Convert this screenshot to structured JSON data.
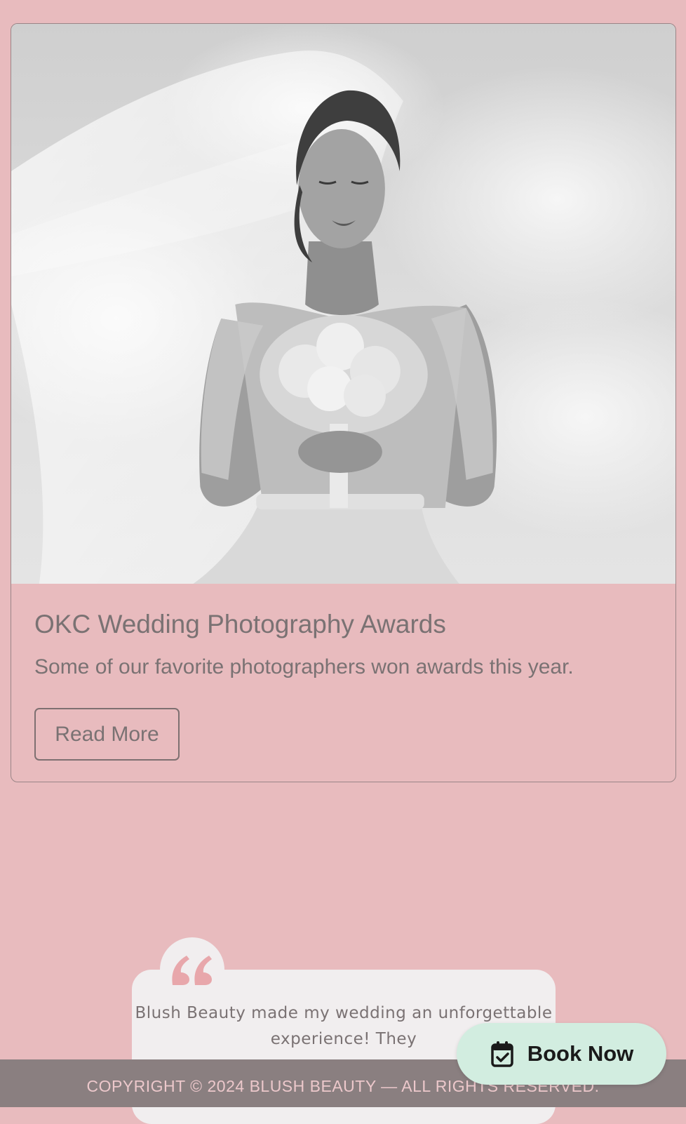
{
  "card": {
    "title": "OKC Wedding Photography Awards",
    "text": "Some of our favorite photographers won awards this year.",
    "read_more_label": "Read More",
    "image_icon": "bride-photo"
  },
  "testimonial": {
    "quote_icon": "quote-icon",
    "text": "Blush Beauty made my wedding an unforgettable experience! They"
  },
  "footer": {
    "copyright": "COPYRIGHT © 2024 BLUSH BEAUTY — ALL RIGHTS RESERVED."
  },
  "book_now": {
    "label": "Book Now",
    "icon": "calendar-check-icon"
  },
  "colors": {
    "page_bg": "#e8bbbe",
    "footer_bg": "#8a7f80",
    "book_now_bg": "#d2ede0",
    "quote_accent": "#e8a7ab"
  }
}
